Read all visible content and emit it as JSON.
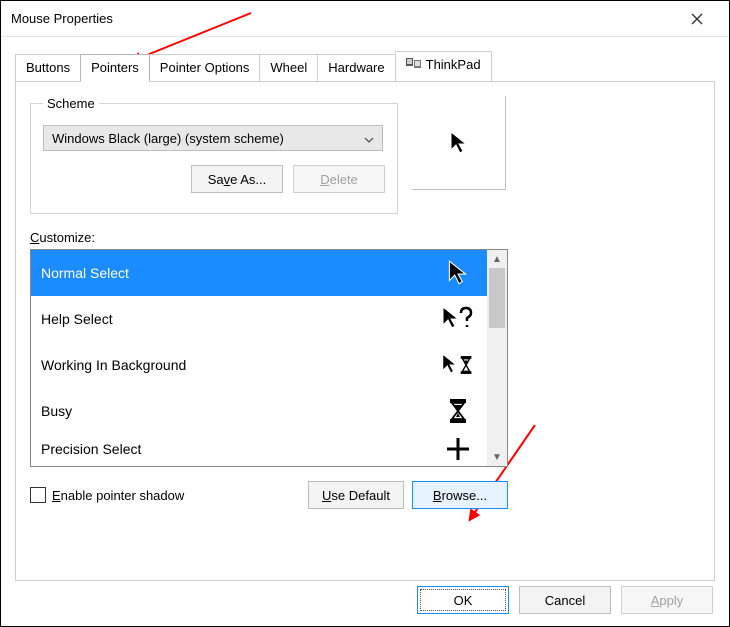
{
  "window": {
    "title": "Mouse Properties"
  },
  "tabs": {
    "items": [
      "Buttons",
      "Pointers",
      "Pointer Options",
      "Wheel",
      "Hardware",
      "ThinkPad"
    ],
    "active_index": 1
  },
  "scheme": {
    "legend": "Scheme",
    "selected": "Windows Black (large) (system scheme)",
    "save_label": "Save As...",
    "delete_label": "Delete"
  },
  "customize": {
    "label": "Customize:",
    "items": [
      {
        "name": "Normal Select",
        "icon": "cursor-arrow",
        "selected": true
      },
      {
        "name": "Help Select",
        "icon": "cursor-help",
        "selected": false
      },
      {
        "name": "Working In Background",
        "icon": "cursor-busy-bg",
        "selected": false
      },
      {
        "name": "Busy",
        "icon": "cursor-hourglass",
        "selected": false
      },
      {
        "name": "Precision Select",
        "icon": "cursor-crosshair",
        "selected": false
      }
    ]
  },
  "options": {
    "shadow_label": "Enable pointer shadow",
    "use_default_label": "Use Default",
    "browse_label": "Browse..."
  },
  "footer": {
    "ok": "OK",
    "cancel": "Cancel",
    "apply": "Apply"
  },
  "annotation": {
    "target_tab": "Pointers",
    "target_button": "Browse..."
  }
}
